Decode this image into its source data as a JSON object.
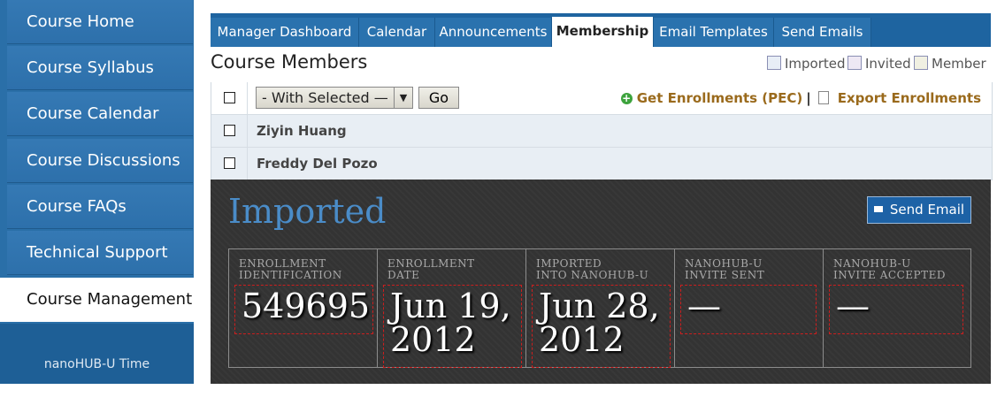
{
  "sidebar": {
    "items": [
      {
        "label": "Course Home"
      },
      {
        "label": "Course Syllabus"
      },
      {
        "label": "Course Calendar"
      },
      {
        "label": "Course Discussions"
      },
      {
        "label": "Course FAQs"
      },
      {
        "label": "Technical Support"
      },
      {
        "label": "Course Management",
        "active": true
      }
    ],
    "footer": "nanoHUB-U Time"
  },
  "tabs": [
    {
      "label": "Manager Dashboard"
    },
    {
      "label": "Calendar"
    },
    {
      "label": "Announcements"
    },
    {
      "label": "Membership",
      "active": true
    },
    {
      "label": "Email Templates"
    },
    {
      "label": "Send Emails"
    }
  ],
  "page": {
    "title": "Course Members",
    "legend": [
      {
        "label": "Imported",
        "color": "#e8eef6"
      },
      {
        "label": "Invited",
        "color": "#eee8f4"
      },
      {
        "label": "Member",
        "color": "#f0f0e2"
      }
    ]
  },
  "table": {
    "bulk_select": "- With Selected —",
    "go_label": "Go",
    "get_enrollments": "Get Enrollments (PEC)",
    "separator": "|",
    "export_enrollments": "Export Enrollments",
    "members": [
      "Ziyin Huang",
      "Freddy Del Pozo"
    ]
  },
  "detail": {
    "status": "Imported",
    "send_email": "Send Email",
    "fields": [
      {
        "label1": "ENROLLMENT",
        "label2": "IDENTIFICATION",
        "value1": "549695",
        "value2": ""
      },
      {
        "label1": "ENROLLMENT",
        "label2": "DATE",
        "value1": "Jun 19,",
        "value2": "2012"
      },
      {
        "label1": "IMPORTED",
        "label2": "INTO NANOHUB-U",
        "value1": "Jun 28,",
        "value2": "2012"
      },
      {
        "label1": "NANOHUB-U",
        "label2": "INVITE SENT",
        "value1": "—",
        "value2": ""
      },
      {
        "label1": "NANOHUB-U",
        "label2": "INVITE ACCEPTED",
        "value1": "—",
        "value2": ""
      }
    ]
  },
  "colors": {
    "sidebar_bg": "#2a6fa8",
    "tab_bar": "#1e64a0",
    "panel_bg": "#333333",
    "status_title": "#4a8cc8",
    "link_color": "#9a6a1c",
    "highlight_border": "#cc1e1e"
  }
}
